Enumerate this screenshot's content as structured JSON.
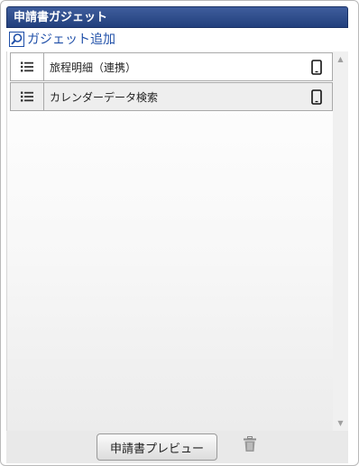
{
  "panel": {
    "title": "申請書ガジェット",
    "add_label": "ガジェット追加",
    "accent_color": "#2b4a8a"
  },
  "gadgets": [
    {
      "label": "旅程明細（連携）",
      "handle_icon": "list-icon",
      "device_icon": "smartphone-icon"
    },
    {
      "label": "カレンダーデータ検索",
      "handle_icon": "list-icon",
      "device_icon": "smartphone-icon"
    }
  ],
  "footer": {
    "preview_label": "申請書プレビュー",
    "trash_icon": "trash-icon"
  }
}
